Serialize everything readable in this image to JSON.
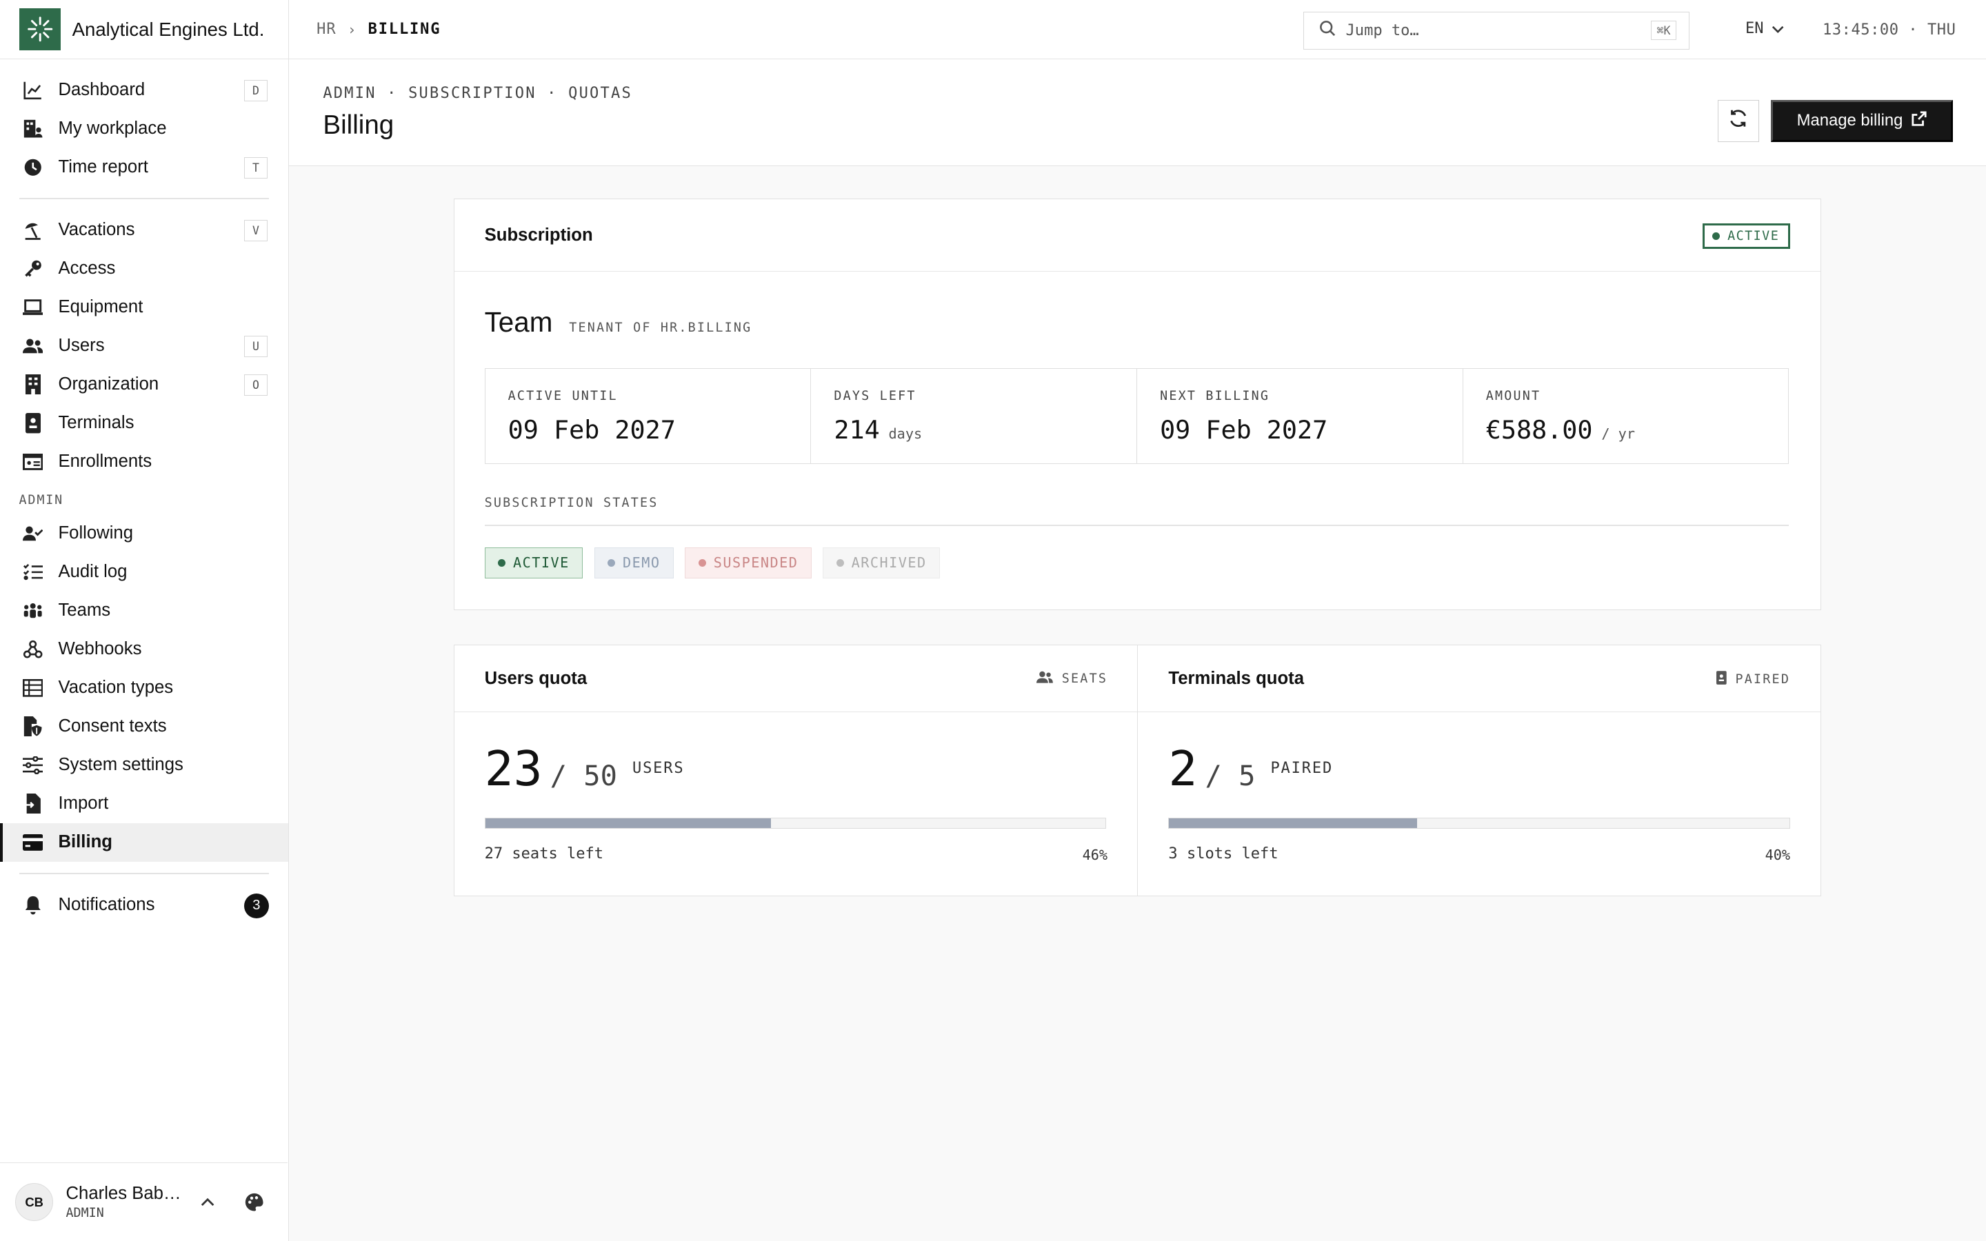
{
  "brand": {
    "name": "Analytical Engines Ltd.",
    "accent": "#2e6b4a"
  },
  "topbar": {
    "breadcrumb": [
      "HR",
      "BILLING"
    ],
    "breadcrumb_sep": "›",
    "search_placeholder": "Jump to…",
    "search_shortcut": "⌘K",
    "language": "EN",
    "clock": "13:45:00 · THU"
  },
  "sidebar": {
    "main": [
      {
        "label": "Dashboard",
        "icon": "chart-line-icon",
        "key": "D"
      },
      {
        "label": "My workplace",
        "icon": "building-user-icon",
        "key": ""
      },
      {
        "label": "Time report",
        "icon": "clock-icon",
        "key": "T"
      }
    ],
    "people": [
      {
        "label": "Vacations",
        "icon": "umbrella-beach-icon",
        "key": "V"
      },
      {
        "label": "Access",
        "icon": "key-icon",
        "key": ""
      },
      {
        "label": "Equipment",
        "icon": "laptop-icon",
        "key": ""
      },
      {
        "label": "Users",
        "icon": "users-icon",
        "key": "U"
      },
      {
        "label": "Organization",
        "icon": "building-icon",
        "key": "O"
      },
      {
        "label": "Terminals",
        "icon": "terminal-device-icon",
        "key": ""
      },
      {
        "label": "Enrollments",
        "icon": "id-card-icon",
        "key": ""
      }
    ],
    "admin_heading": "ADMIN",
    "admin": [
      {
        "label": "Following",
        "icon": "user-check-icon"
      },
      {
        "label": "Audit log",
        "icon": "list-check-icon"
      },
      {
        "label": "Teams",
        "icon": "people-group-icon"
      },
      {
        "label": "Webhooks",
        "icon": "webhook-icon"
      },
      {
        "label": "Vacation types",
        "icon": "table-list-icon"
      },
      {
        "label": "Consent texts",
        "icon": "file-shield-icon"
      },
      {
        "label": "System settings",
        "icon": "sliders-icon"
      },
      {
        "label": "Import",
        "icon": "file-import-icon"
      },
      {
        "label": "Billing",
        "icon": "credit-card-icon",
        "active": true
      }
    ],
    "notifications": {
      "label": "Notifications",
      "icon": "bell-icon",
      "count": "3"
    },
    "user": {
      "initials": "CB",
      "name": "Charles Bab…",
      "role": "ADMIN"
    }
  },
  "page": {
    "crumb": "ADMIN · SUBSCRIPTION · QUOTAS",
    "title": "Billing",
    "manage_label": "Manage billing"
  },
  "subscription": {
    "title": "Subscription",
    "status": "ACTIVE",
    "plan": "Team",
    "tenant": "TENANT OF HR.BILLING",
    "metrics": [
      {
        "label": "ACTIVE UNTIL",
        "value": "09 Feb 2027",
        "unit": ""
      },
      {
        "label": "DAYS LEFT",
        "value": "214",
        "unit": "days"
      },
      {
        "label": "NEXT BILLING",
        "value": "09 Feb 2027",
        "unit": ""
      },
      {
        "label": "AMOUNT",
        "value": "€588.00",
        "unit": "/ yr"
      }
    ],
    "states_label": "SUBSCRIPTION STATES",
    "states": [
      {
        "label": "ACTIVE",
        "color": "#2e6b4a"
      },
      {
        "label": "DEMO",
        "color": "#9aa8bb"
      },
      {
        "label": "SUSPENDED",
        "color": "#d89393"
      },
      {
        "label": "ARCHIVED",
        "color": "#bdbdbd"
      }
    ]
  },
  "quotas": {
    "users": {
      "title": "Users quota",
      "tag": "SEATS",
      "used": "23",
      "total": "/ 50",
      "unit": "USERS",
      "fraction": 0.46,
      "left": "27 seats left",
      "pct": "46%"
    },
    "terminals": {
      "title": "Terminals quota",
      "tag": "PAIRED",
      "used": "2",
      "total": "/ 5",
      "unit": "PAIRED",
      "fraction": 0.4,
      "left": "3 slots left",
      "pct": "40%"
    }
  }
}
